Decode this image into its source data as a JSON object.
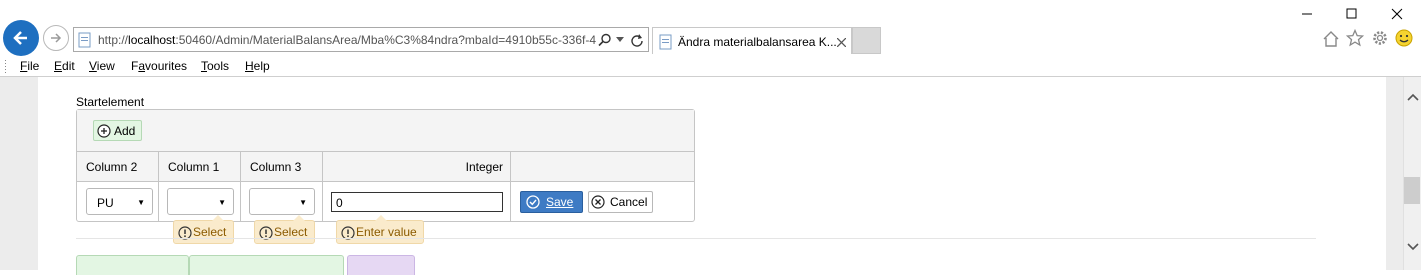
{
  "browser": {
    "url_prefix": "http://",
    "url_host": "localhost",
    "url_rest": ":50460/Admin/MaterialBalansArea/Mba%C3%84ndra?mbaId=4910b55c-336f-4",
    "tab_title": "Ändra materialbalansarea K..."
  },
  "menu": {
    "items": [
      {
        "mnemonic": "F",
        "rest": "ile"
      },
      {
        "mnemonic": "E",
        "rest": "dit"
      },
      {
        "mnemonic": "V",
        "rest": "iew"
      },
      {
        "mnemonic": "a",
        "before": "F",
        "rest": "vourites"
      },
      {
        "mnemonic": "T",
        "rest": "ools"
      },
      {
        "mnemonic": "H",
        "rest": "elp"
      }
    ]
  },
  "section": {
    "label": "Startelement"
  },
  "grid": {
    "add_label": "Add",
    "columns": [
      "Column 2",
      "Column 1",
      "Column 3",
      "Integer",
      ""
    ],
    "row": {
      "column2_value": "PU",
      "column1_value": "",
      "column3_value": "",
      "integer_value": "0"
    },
    "save_label": "Save",
    "cancel_label": "Cancel"
  },
  "validation": {
    "column1_msg": "Select",
    "column3_msg": "Select",
    "integer_msg": "Enter value"
  },
  "colors": {
    "back_button": "#1e6fc0",
    "add_button_bg": "#e3f6e3",
    "save_button_bg": "#3e7bc4",
    "tooltip_bg": "#faebcc",
    "tooltip_text": "#8a5a00"
  }
}
